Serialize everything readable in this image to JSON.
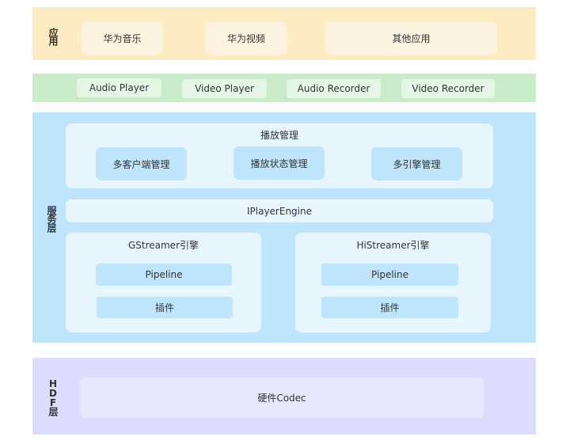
{
  "layers": {
    "app": {
      "label": "应用",
      "items": [
        "华为音乐",
        "华为视频",
        "其他应用"
      ]
    },
    "framework": {
      "items": [
        "Audio Player",
        "Video Player",
        "Audio Recorder",
        "Video Recorder"
      ]
    },
    "service": {
      "label": "服务层",
      "playback_management": {
        "title": "播放管理",
        "items": [
          "多客户端管理",
          "播放状态管理",
          "多引擎管理"
        ]
      },
      "engine_interface": "IPlayerEngine",
      "engines": [
        {
          "title": "GStreamer引擎",
          "items": [
            "Pipeline",
            "插件"
          ]
        },
        {
          "title": "HiStreamer引擎",
          "items": [
            "Pipeline",
            "插件"
          ]
        }
      ]
    },
    "hdf": {
      "label": "HDF层",
      "items": [
        "硬件Codec"
      ]
    }
  },
  "colors": {
    "app_layer": "#fdebc2",
    "framework_layer": "#c9ebcb",
    "service_layer": "#bfe5fc",
    "hdf_layer": "#dcdcfc"
  }
}
